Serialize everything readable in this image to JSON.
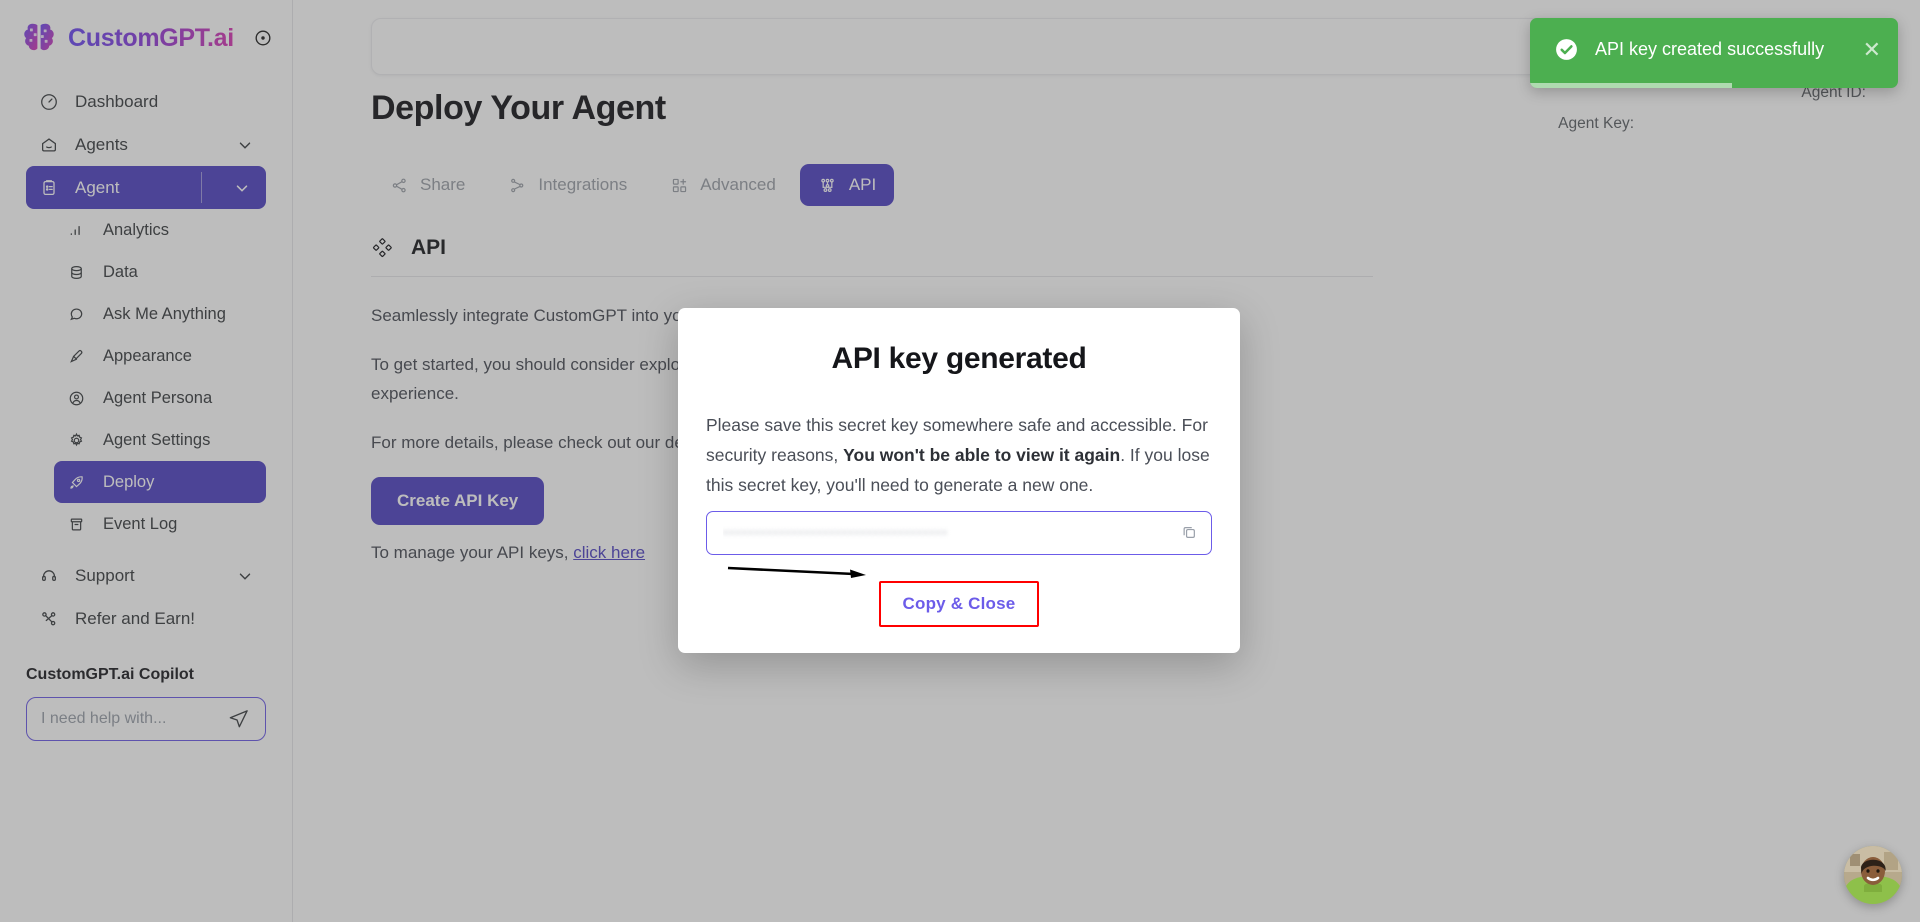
{
  "brand": {
    "name": "CustomGPT.ai",
    "collapse_icon": "circle-dot-icon"
  },
  "sidebar": {
    "items": [
      {
        "label": "Dashboard",
        "icon": "gauge-icon",
        "type": "item"
      },
      {
        "label": "Agents",
        "icon": "home-icon",
        "type": "expandable"
      },
      {
        "label": "Agent",
        "icon": "clipboard-icon",
        "type": "expandable-active"
      }
    ],
    "sub_items": [
      {
        "label": "Analytics",
        "icon": "bar-chart-icon"
      },
      {
        "label": "Data",
        "icon": "database-icon"
      },
      {
        "label": "Ask Me Anything",
        "icon": "chat-bubble-icon"
      },
      {
        "label": "Appearance",
        "icon": "paintbrush-icon"
      },
      {
        "label": "Agent Persona",
        "icon": "user-circle-icon"
      },
      {
        "label": "Agent Settings",
        "icon": "gear-icon"
      },
      {
        "label": "Deploy",
        "icon": "rocket-icon",
        "active": true
      },
      {
        "label": "Event Log",
        "icon": "archive-icon"
      }
    ],
    "footer_items": [
      {
        "label": "Support",
        "icon": "headset-icon",
        "type": "expandable"
      },
      {
        "label": "Refer and Earn!",
        "icon": "share-nodes-icon",
        "type": "item"
      }
    ],
    "copilot": {
      "title": "CustomGPT.ai Copilot",
      "placeholder": "I need help with...",
      "send_icon": "paper-plane-icon"
    }
  },
  "main": {
    "agent_id_label": "Agent ID:",
    "agent_key_label": "Agent Key:",
    "page_title": "Deploy Your Agent",
    "tabs": [
      {
        "label": "Share",
        "icon": "share-icon",
        "active": false
      },
      {
        "label": "Integrations",
        "icon": "integrations-icon",
        "active": false
      },
      {
        "label": "Advanced",
        "icon": "squares-plus-icon",
        "active": false
      },
      {
        "label": "API",
        "icon": "api-nodes-icon",
        "active": true
      }
    ],
    "section": {
      "icon": "diamonds-icon",
      "title": "API",
      "paragraph_1": "Seamlessly integrate CustomGPT into your workflow for enhanced decision making and efficiency.",
      "paragraph_2": "To get started, you should consider exploring our API documentation through a hands-on, interactive experience.",
      "paragraph_3": "For more details, please check out our developer documentation.",
      "create_button": "Create API Key",
      "manage_prefix": "To manage your API keys, ",
      "manage_link": "click here"
    }
  },
  "modal": {
    "title": "API key generated",
    "body_part_1": "Please save this secret key somewhere safe and accessible. For security reasons, ",
    "body_bold": "You won't be able to view it again",
    "body_part_2": ". If you lose this secret key, you'll need to generate a new one.",
    "key_value": "••••••••••••••••••••••••••••••••••••",
    "copy_icon": "copy-icon",
    "action_label": "Copy & Close",
    "highlight_color": "#ff0000",
    "accent_color": "#6c5ce9"
  },
  "toast": {
    "message": "API key created successfully",
    "icon": "check-circle-icon",
    "close_icon": "close-icon",
    "background": "#4caf50",
    "progress_percent": 55
  },
  "chat_widget": {
    "icon": "agent-avatar",
    "label": "avatar"
  }
}
